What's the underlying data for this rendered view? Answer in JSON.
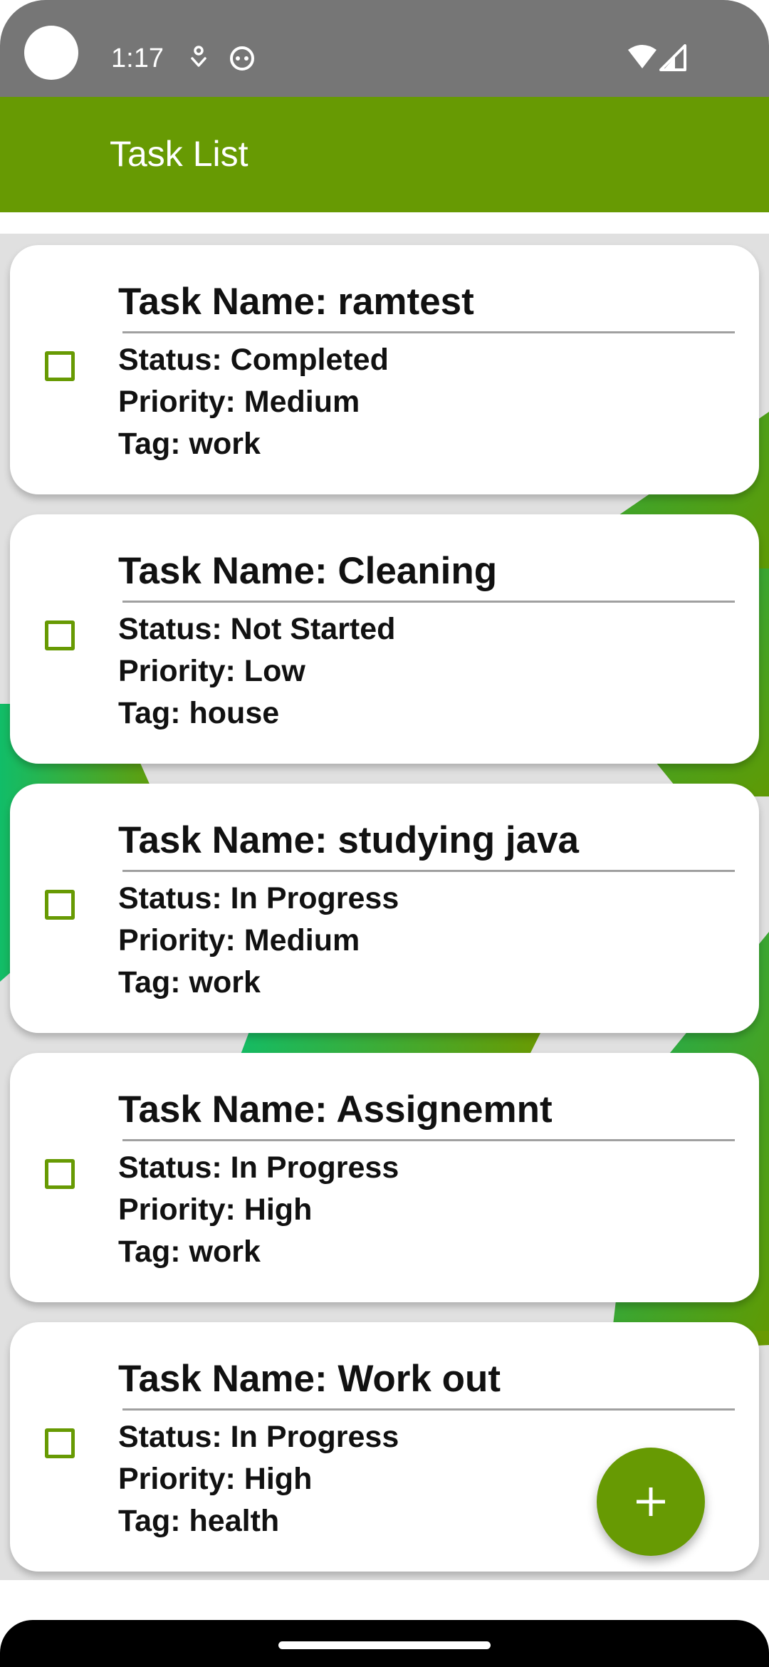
{
  "status_bar": {
    "time": "1:17",
    "icons": [
      "camera-cutout",
      "app-notification-icon",
      "android-debug-icon",
      "wifi-icon",
      "cell-signal-icon"
    ]
  },
  "app_bar": {
    "title": "Task List"
  },
  "tasks": [
    {
      "name": "Task Name: ramtest",
      "status": "Status: Completed",
      "priority": "Priority: Medium",
      "tag": "Tag: work"
    },
    {
      "name": "Task Name: Cleaning",
      "status": "Status: Not Started",
      "priority": "Priority: Low",
      "tag": "Tag: house"
    },
    {
      "name": "Task Name: studying java",
      "status": "Status: In Progress",
      "priority": "Priority: Medium",
      "tag": "Tag: work"
    },
    {
      "name": "Task Name: Assignemnt",
      "status": "Status: In Progress",
      "priority": "Priority: High",
      "tag": "Tag: work"
    },
    {
      "name": "Task Name: Work out",
      "status": "Status: In Progress",
      "priority": "Priority: High",
      "tag": "Tag: health"
    }
  ],
  "fab": {
    "icon": "plus-icon"
  },
  "colors": {
    "primary": "#679a03",
    "background_accent": "#0fbd6a",
    "status_bar": "#767676",
    "card": "#ffffff",
    "text": "#111111"
  }
}
